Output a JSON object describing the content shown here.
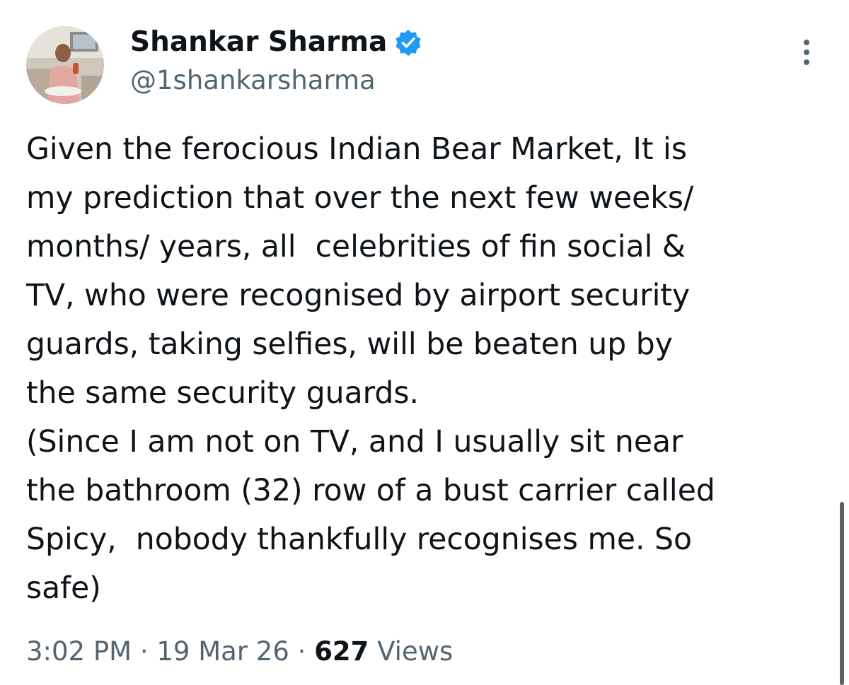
{
  "author": {
    "name": "Shankar Sharma",
    "handle": "@1shankarsharma",
    "verified": true,
    "verified_color": "#1d9bf0"
  },
  "icons": {
    "avatar": "profile-photo",
    "verified": "verified-badge-icon",
    "more": "more-options-icon"
  },
  "tweet": {
    "lines": [
      "Given the ferocious Indian Bear Market, It is",
      "my prediction that over the next few weeks/",
      "months/ years, all  celebrities of fin social &",
      "TV, who were recognised by airport security",
      "guards, taking selfies, will be beaten up by",
      "the same security guards.",
      "(Since I am not on TV, and I usually sit near",
      "the bathroom (32) row of a bust carrier called",
      "Spicy,  nobody thankfully recognises me. So",
      "safe)"
    ]
  },
  "meta": {
    "time": "3:02 PM",
    "separator": " · ",
    "date": "19 Mar 26",
    "views_count": "627",
    "views_label": " Views"
  },
  "colors": {
    "text_primary": "#0f1419",
    "text_secondary": "#536471",
    "background": "#ffffff"
  }
}
